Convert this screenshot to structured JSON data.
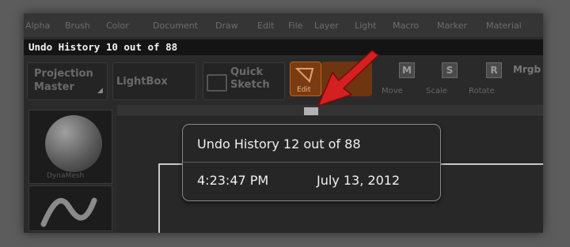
{
  "menubar": {
    "items": [
      "Alpha",
      "Brush",
      "Color",
      "Document",
      "Draw",
      "Edit",
      "File",
      "Layer",
      "Light",
      "Macro",
      "Marker",
      "Material"
    ]
  },
  "titlebar": {
    "title": "Undo History 10 out of 88"
  },
  "toolbar": {
    "projection_master_line1": "Projection",
    "projection_master_line2": "Master",
    "lightbox_label": "LightBox",
    "quick_sketch_line1": "Quick",
    "quick_sketch_line2": "Sketch",
    "edit_label": "Edit",
    "move_label": "Move",
    "move_key": "M",
    "scale_label": "Scale",
    "scale_key": "S",
    "rotate_label": "Rotate",
    "rotate_key": "R",
    "mrgb_label": "Mrgb"
  },
  "left_panel": {
    "thumb1_label": "DynaMesh"
  },
  "tooltip": {
    "title": "Undo History 12 out of 88",
    "time": "4:23:47 PM",
    "date": "July 13, 2012"
  },
  "colors": {
    "arrow": "#d42020",
    "edit_active": "#c0621e"
  }
}
